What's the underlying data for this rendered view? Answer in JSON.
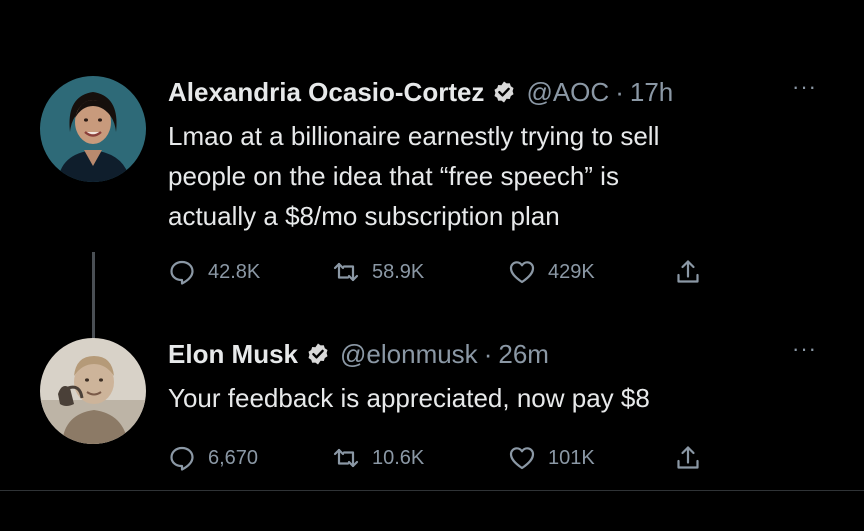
{
  "tweets": [
    {
      "avatar_icon": "aoc-avatar",
      "name": "Alexandria Ocasio-Cortez",
      "verified": true,
      "handle": "@AOC",
      "separator": "·",
      "time": "17h",
      "more_icon": "···",
      "text": "Lmao at a billionaire earnestly trying to sell\npeople on the idea that “free speech” is\nactually a $8/mo subscription plan",
      "replies": "42.8K",
      "retweets": "58.9K",
      "likes": "429K"
    },
    {
      "avatar_icon": "elon-musk-avatar",
      "name": "Elon Musk",
      "verified": true,
      "handle": "@elonmusk",
      "separator": "·",
      "time": "26m",
      "more_icon": "···",
      "text": "Your feedback is appreciated, now pay $8",
      "replies": "6,670",
      "retweets": "10.6K",
      "likes": "101K"
    }
  ],
  "colors": {
    "background": "#000000",
    "text": "#e7e9ea",
    "secondary": "#8b98a5",
    "verified_badge": "#d9d9d9"
  }
}
